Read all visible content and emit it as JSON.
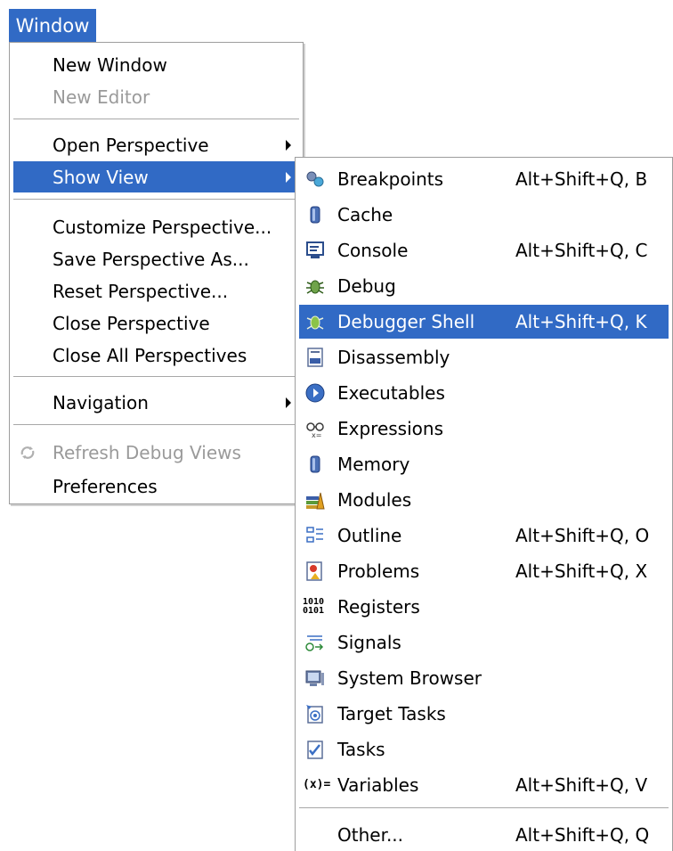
{
  "menubar": {
    "window_label": "Window"
  },
  "window_menu": {
    "items": [
      {
        "label": "New Window"
      },
      {
        "label": "New Editor"
      },
      {
        "label": "Open Perspective"
      },
      {
        "label": "Show View"
      },
      {
        "label": "Customize Perspective..."
      },
      {
        "label": "Save Perspective As..."
      },
      {
        "label": "Reset Perspective..."
      },
      {
        "label": "Close Perspective"
      },
      {
        "label": "Close All Perspectives"
      },
      {
        "label": "Navigation"
      },
      {
        "label": "Refresh Debug Views"
      },
      {
        "label": "Preferences"
      }
    ]
  },
  "show_view_menu": {
    "items": [
      {
        "label": "Breakpoints",
        "shortcut": "Alt+Shift+Q, B",
        "icon": "breakpoints-icon"
      },
      {
        "label": "Cache",
        "shortcut": "",
        "icon": "cache-icon"
      },
      {
        "label": "Console",
        "shortcut": "Alt+Shift+Q, C",
        "icon": "console-icon"
      },
      {
        "label": "Debug",
        "shortcut": "",
        "icon": "debug-icon"
      },
      {
        "label": "Debugger Shell",
        "shortcut": "Alt+Shift+Q, K",
        "icon": "debugger-shell-icon"
      },
      {
        "label": "Disassembly",
        "shortcut": "",
        "icon": "disassembly-icon"
      },
      {
        "label": "Executables",
        "shortcut": "",
        "icon": "executables-icon"
      },
      {
        "label": "Expressions",
        "shortcut": "",
        "icon": "expressions-icon"
      },
      {
        "label": "Memory",
        "shortcut": "",
        "icon": "memory-icon"
      },
      {
        "label": "Modules",
        "shortcut": "",
        "icon": "modules-icon"
      },
      {
        "label": "Outline",
        "shortcut": "Alt+Shift+Q, O",
        "icon": "outline-icon"
      },
      {
        "label": "Problems",
        "shortcut": "Alt+Shift+Q, X",
        "icon": "problems-icon"
      },
      {
        "label": "Registers",
        "shortcut": "",
        "icon": "registers-icon"
      },
      {
        "label": "Signals",
        "shortcut": "",
        "icon": "signals-icon"
      },
      {
        "label": "System Browser",
        "shortcut": "",
        "icon": "system-browser-icon"
      },
      {
        "label": "Target Tasks",
        "shortcut": "",
        "icon": "target-tasks-icon"
      },
      {
        "label": "Tasks",
        "shortcut": "",
        "icon": "tasks-icon"
      },
      {
        "label": "Variables",
        "shortcut": "Alt+Shift+Q, V",
        "icon": "variables-icon"
      },
      {
        "label": "Other...",
        "shortcut": "Alt+Shift+Q, Q"
      }
    ],
    "icon_text": {
      "registers": "1010\n0101",
      "variables": "(x)="
    }
  },
  "colors": {
    "selection": "#316ac5",
    "disabled_text": "#9a9a9a"
  }
}
